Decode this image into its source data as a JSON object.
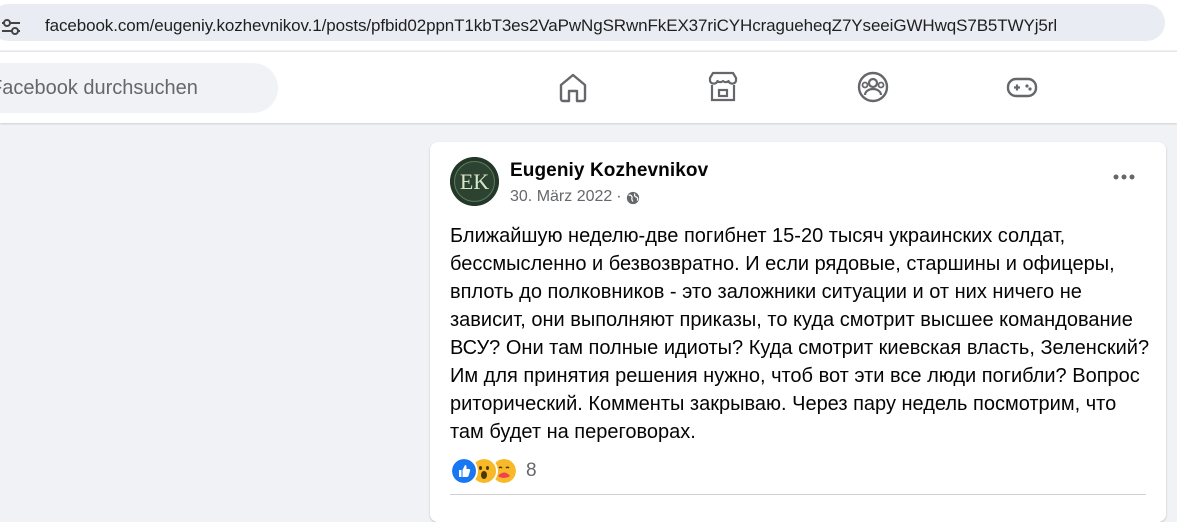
{
  "browser": {
    "url": "facebook.com/eugeniy.kozhevnikov.1/posts/pfbid02ppnT1kbT3es2VaPwNgSRwnFkEX37riCYHcragueheqZ7YseeiGWHwqS7B5TWYj5rl",
    "site_info_icon": "tune-icon"
  },
  "nav": {
    "search_placeholder": "Facebook durchsuchen",
    "items": [
      {
        "icon": "home-icon"
      },
      {
        "icon": "marketplace-icon"
      },
      {
        "icon": "groups-icon"
      },
      {
        "icon": "gaming-icon"
      }
    ]
  },
  "post": {
    "author": "Eugeniy Kozhevnikov",
    "avatar_initials": "EK",
    "date": "30. März 2022",
    "separator": "·",
    "privacy_icon": "globe-icon",
    "text": "Ближайшую неделю-две погибнет 15-20 тысяч украинских солдат, бессмысленно и безвозвратно. И если рядовые, старшины и офицеры, вплоть до полковников - это заложники ситуации и от них ничего не зависит, они выполняют приказы, то куда смотрит высшее командование ВСУ? Они там полные идиоты? Куда смотрит киевская власть, Зеленский? Им для принятия решения нужно, чтоб вот эти все люди погибли? Вопрос риторический. Комменты закрываю. Через пару недель посмотрим, что там будет на переговорах.",
    "reactions": [
      "like",
      "wow",
      "care"
    ],
    "reaction_count": "8"
  },
  "colors": {
    "background": "#f0f2f5",
    "card": "#ffffff",
    "like_blue": "#1877f2",
    "wow_yellow": "#f7b928",
    "secondary_text": "#65676b"
  }
}
